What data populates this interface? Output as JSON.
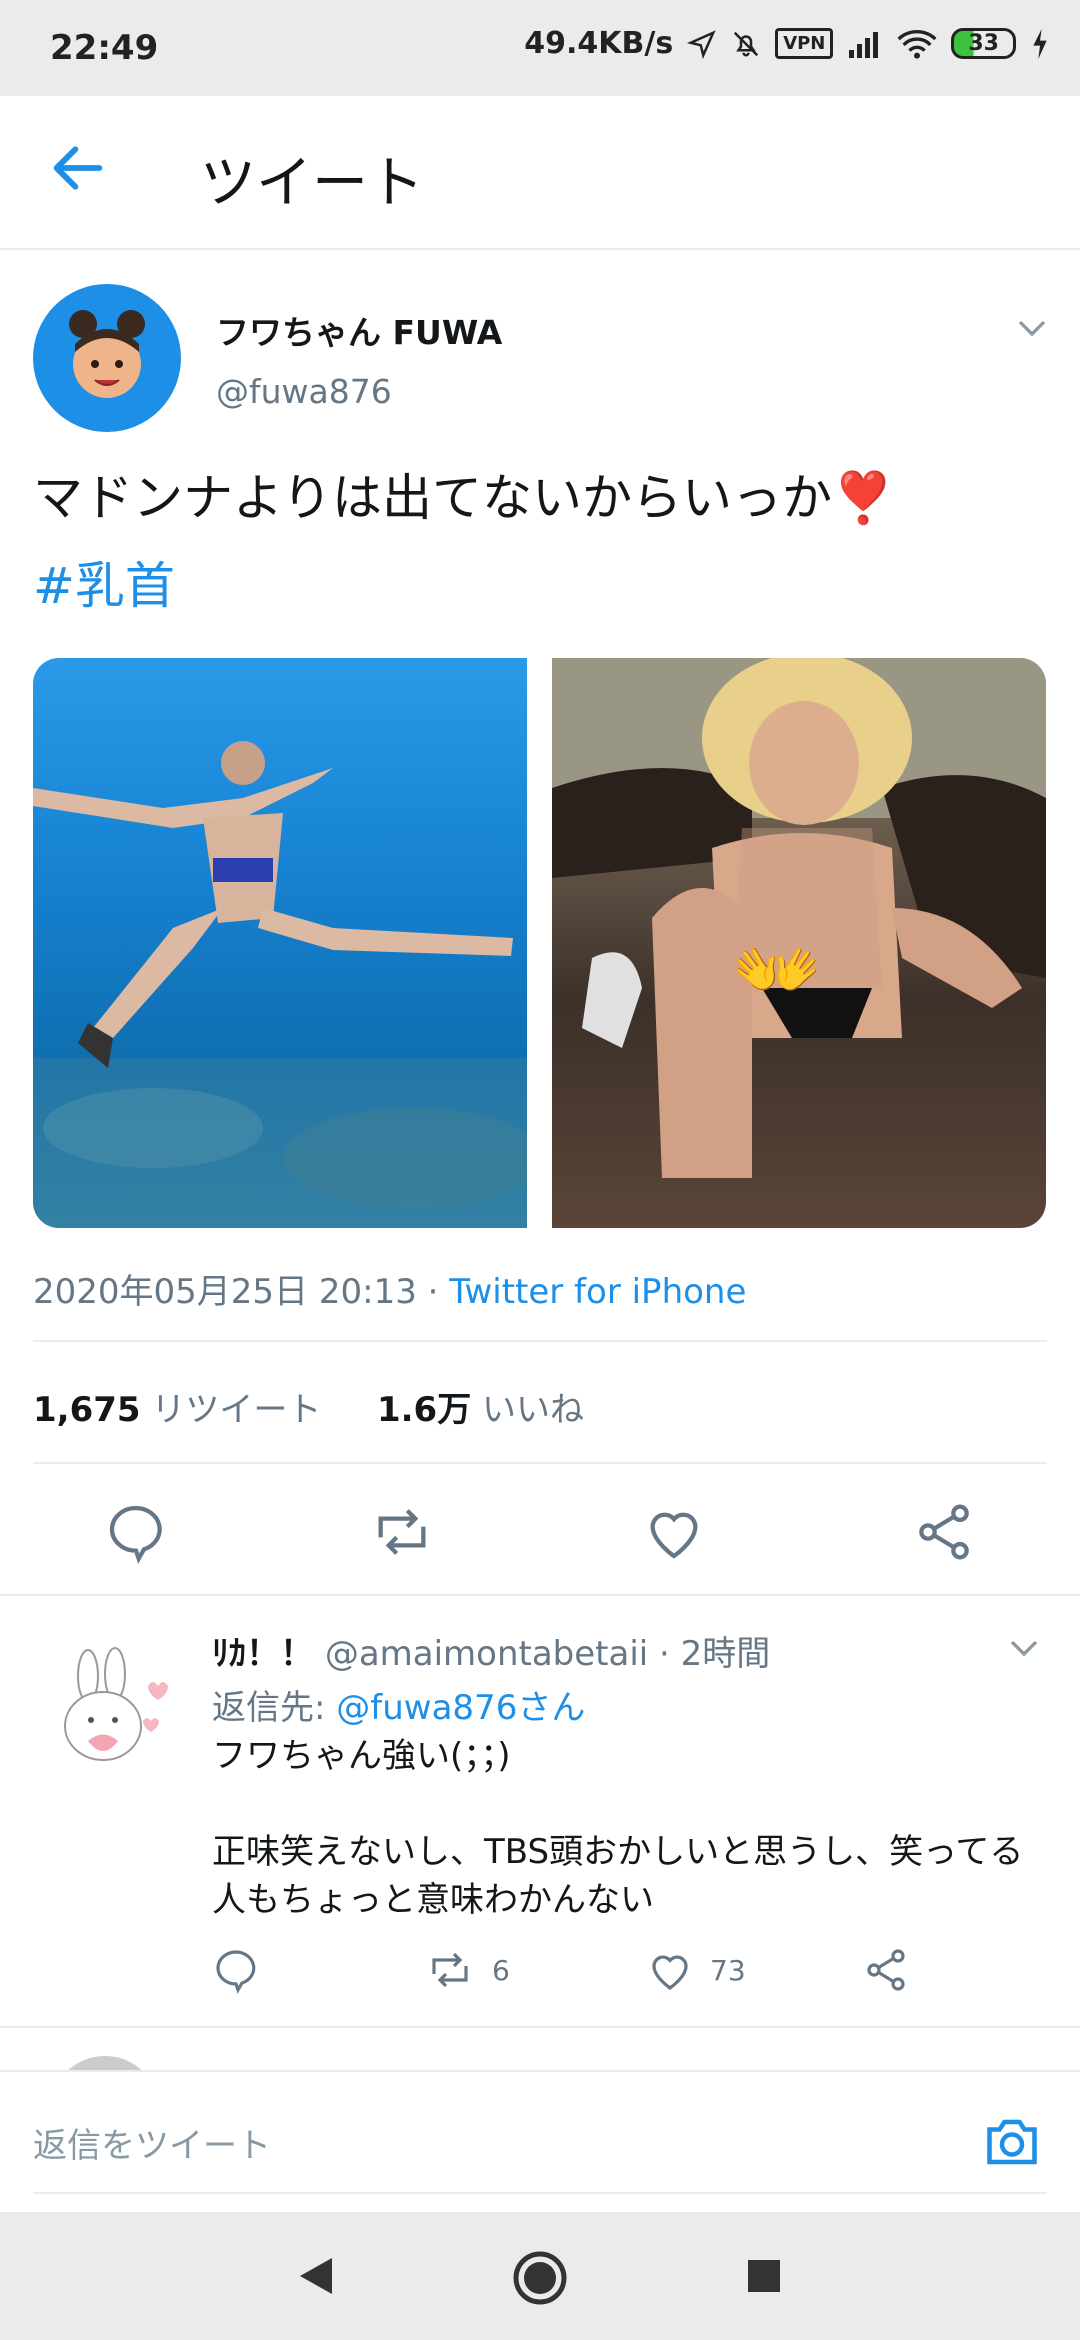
{
  "status_bar": {
    "time": "22:49",
    "speed": "49.4KB/s",
    "vpn": "VPN",
    "battery": "33"
  },
  "header": {
    "title": "ツイート"
  },
  "tweet": {
    "author_name": "フワちゃん FUWA",
    "author_handle": "@fuwa876",
    "text": "マドンナよりは出てないからいっか",
    "heart_emoji": "❣️",
    "hashtag": "#乳首",
    "hands_emoji": "👐",
    "timestamp": "2020年05月25日 20:13",
    "separator": " · ",
    "source": "Twitter for iPhone",
    "retweet_count": "1,675",
    "retweet_label": "リツイート",
    "like_count": "1.6万",
    "like_label": "いいね"
  },
  "reply": {
    "name": "ﾘｶ！！",
    "handle": "@amaimontabetaii",
    "time": " · 2時間",
    "reply_to_label": "返信先: ",
    "reply_to_handle": "@fuwa876さん",
    "text_line1": "フワちゃん強い(；；)",
    "text_line2": "正味笑えないし、TBS頭おかしいと思うし、笑ってる人もちょっと意味わかんない",
    "retweet_count": "6",
    "like_count": "73"
  },
  "compose": {
    "placeholder": "返信をツイート"
  },
  "colors": {
    "accent": "#1d8fe6",
    "secondary_text": "#657786",
    "divider": "#e6ecf0"
  }
}
